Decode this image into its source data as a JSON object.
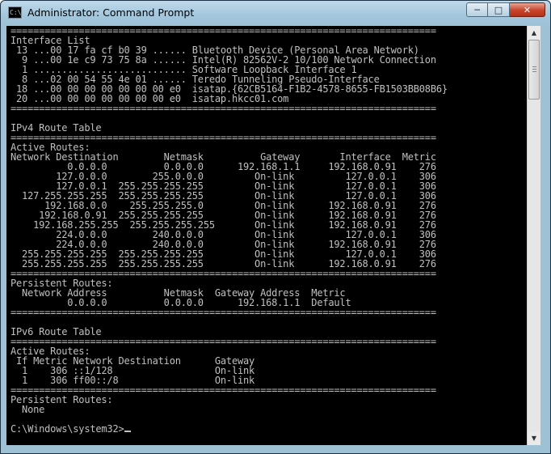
{
  "window": {
    "title": "Administrator: Command Prompt",
    "icon_label": "C:\\",
    "buttons": {
      "minimize": "─",
      "maximize": "□",
      "close": "✕"
    }
  },
  "console": {
    "lines": [
      "===========================================================================",
      "Interface List",
      " 13 ...00 17 fa cf b0 39 ...... Bluetooth Device (Personal Area Network)",
      "  9 ...00 1e c9 73 75 8a ...... Intel(R) 82562V-2 10/100 Network Connection",
      "  1 ........................... Software Loopback Interface 1",
      "  8 ...02 00 54 55 4e 01 ...... Teredo Tunneling Pseudo-Interface",
      " 18 ...00 00 00 00 00 00 00 e0  isatap.{62CB5164-F1B2-4578-8655-FB1503BB08B6}",
      " 20 ...00 00 00 00 00 00 00 e0  isatap.hkcc01.com",
      "===========================================================================",
      "",
      "IPv4 Route Table",
      "===========================================================================",
      "Active Routes:",
      "Network Destination        Netmask          Gateway       Interface  Metric",
      "          0.0.0.0          0.0.0.0      192.168.1.1     192.168.0.91    276",
      "        127.0.0.0        255.0.0.0         On-link         127.0.0.1    306",
      "        127.0.0.1  255.255.255.255         On-link         127.0.0.1    306",
      "  127.255.255.255  255.255.255.255         On-link         127.0.0.1    306",
      "      192.168.0.0    255.255.255.0         On-link      192.168.0.91    276",
      "     192.168.0.91  255.255.255.255         On-link      192.168.0.91    276",
      "    192.168.255.255  255.255.255.255       On-link      192.168.0.91    276",
      "        224.0.0.0        240.0.0.0         On-link         127.0.0.1    306",
      "        224.0.0.0        240.0.0.0         On-link      192.168.0.91    276",
      "  255.255.255.255  255.255.255.255         On-link         127.0.0.1    306",
      "  255.255.255.255  255.255.255.255         On-link      192.168.0.91    276",
      "===========================================================================",
      "Persistent Routes:",
      "  Network Address          Netmask  Gateway Address  Metric",
      "          0.0.0.0          0.0.0.0      192.168.1.1  Default",
      "===========================================================================",
      "",
      "IPv6 Route Table",
      "===========================================================================",
      "Active Routes:",
      " If Metric Network Destination      Gateway",
      "  1    306 ::1/128                  On-link",
      "  1    306 ff00::/8                 On-link",
      "===========================================================================",
      "Persistent Routes:",
      "  None",
      "",
      "C:\\Windows\\system32>"
    ]
  },
  "scrollbar": {
    "up_arrow": "▲",
    "down_arrow": "▼"
  }
}
